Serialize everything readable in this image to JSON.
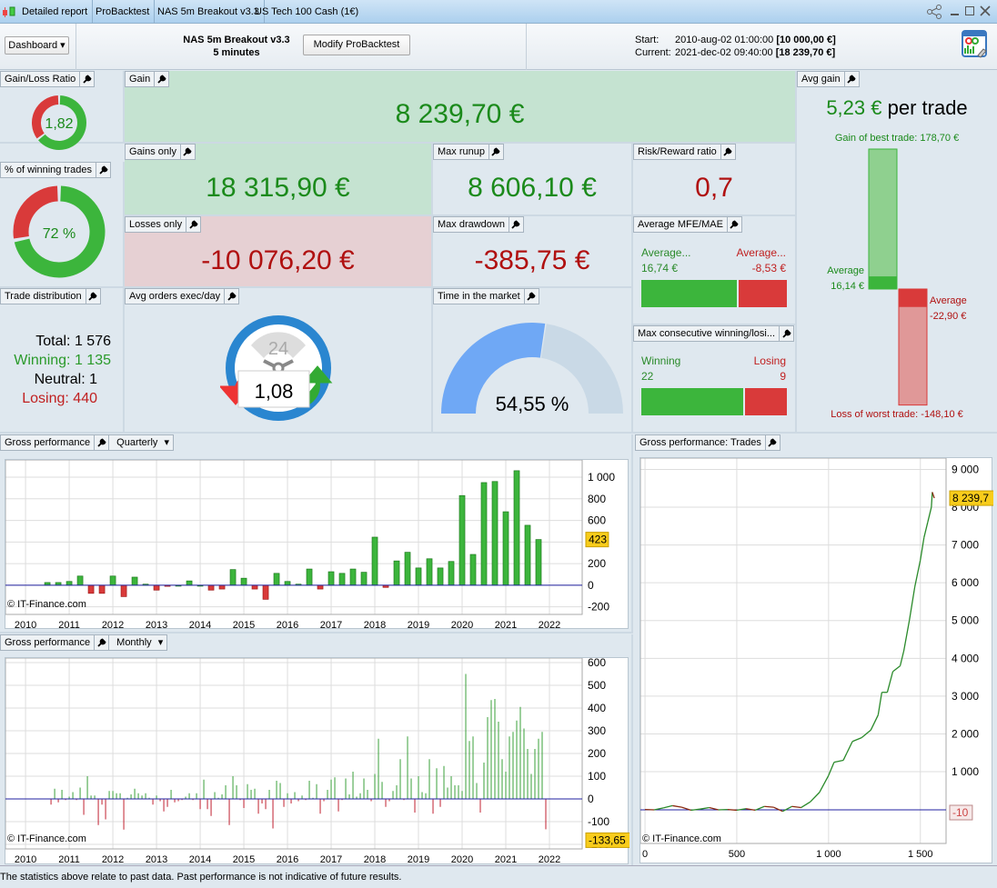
{
  "titlebar": {
    "tabs": [
      "Detailed report",
      "ProBacktest",
      "NAS 5m Breakout v3.3",
      "US Tech 100 Cash (1€)"
    ],
    "icons": [
      "candlestick-icon",
      "share-icon",
      "minimize-icon",
      "maximize-icon",
      "close-icon"
    ]
  },
  "header": {
    "dashboard_label": "Dashboard",
    "strategy_name": "NAS 5m Breakout v3.3",
    "timeframe": "5 minutes",
    "modify_label": "Modify ProBacktest",
    "start_label": "Start:",
    "start_date": "2010-aug-02 01:00:00",
    "start_capital": "[10 000,00 €]",
    "current_label": "Current:",
    "current_date": "2021-dec-02 09:40:00",
    "current_capital": "[18 239,70 €]"
  },
  "panels": {
    "gain_loss_ratio": {
      "label": "Gain/Loss Ratio",
      "value": "1,82",
      "ratio": 1.82
    },
    "winning_pct": {
      "label": "% of winning trades",
      "value": "72 %",
      "percent": 72
    },
    "trade_distribution": {
      "label": "Trade distribution",
      "total_label": "Total:",
      "total": "1 576",
      "winning_label": "Winning:",
      "winning": "1 135",
      "neutral_label": "Neutral:",
      "neutral": "1",
      "losing_label": "Losing:",
      "losing": "440"
    },
    "gain": {
      "label": "Gain",
      "value": "8 239,70 €"
    },
    "gains_only": {
      "label": "Gains only",
      "value": "18 315,90 €"
    },
    "losses_only": {
      "label": "Losses only",
      "value": "-10 076,20 €"
    },
    "max_runup": {
      "label": "Max runup",
      "value": "8 606,10 €"
    },
    "max_drawdown": {
      "label": "Max drawdown",
      "value": "-385,75 €"
    },
    "risk_reward": {
      "label": "Risk/Reward ratio",
      "value": "0,7"
    },
    "mfe_mae": {
      "label": "Average MFE/MAE",
      "left_label": "Average...",
      "left_value": "16,74 €",
      "right_label": "Average...",
      "right_value": "-8,53 €",
      "mfe": 16.74,
      "mae": 8.53
    },
    "max_consecutive": {
      "label": "Max consecutive winning/losi...",
      "left_label": "Winning",
      "left_value": "22",
      "right_label": "Losing",
      "right_value": "9",
      "winning": 22,
      "losing": 9
    },
    "avg_orders": {
      "label": "Avg orders exec/day",
      "value": "1,08",
      "clock_label": "24"
    },
    "time_in_market": {
      "label": "Time in the market",
      "value": "54,55 %",
      "percent": 54.55
    },
    "avg_gain": {
      "label": "Avg gain",
      "value": "5,23 €",
      "suffix": "per trade",
      "best_label": "Gain of best trade: 178,70 €",
      "avg_win_label": "Average",
      "avg_win_value": "16,14 €",
      "avg_loss_label": "Average",
      "avg_loss_value": "-22,90 €",
      "worst_label": "Loss of worst trade: -148,10 €",
      "best": 178.7,
      "avg_win": 16.14,
      "avg_loss": -22.9,
      "worst": -148.1
    }
  },
  "quarterly": {
    "label": "Gross performance",
    "period": "Quarterly",
    "watermark": "© IT-Finance.com",
    "last_label": "423"
  },
  "monthly": {
    "label": "Gross performance",
    "period": "Monthly",
    "watermark": "© IT-Finance.com",
    "last_label": "-133,65"
  },
  "trades": {
    "label": "Gross performance: Trades",
    "watermark": "© IT-Finance.com",
    "last_label": "8 239,7",
    "zero_label": "-10"
  },
  "footer": "The statistics above relate to past data. Past performance is not indicative of future results.",
  "colors": {
    "gain": "#1b8a1b",
    "loss": "#b01010",
    "bar_green": "#3cb53c",
    "bar_red": "#d93a3a",
    "gauge_blue": "#6fa8f5",
    "highlight": "#f8cc1b"
  },
  "chart_data": [
    {
      "type": "bar",
      "title": "Gross performance",
      "period": "Quarterly",
      "x_ticks": [
        "2010",
        "2011",
        "2012",
        "2013",
        "2014",
        "2015",
        "2016",
        "2017",
        "2018",
        "2019",
        "2020",
        "2021",
        "2022"
      ],
      "y_ticks": [
        "-200",
        "0",
        "200",
        "400",
        "600",
        "800",
        "1 000"
      ],
      "ylim": [
        -270,
        1160
      ],
      "grid": true,
      "categories": [
        "2010-Q3",
        "2010-Q4",
        "2011-Q1",
        "2011-Q2",
        "2011-Q3",
        "2011-Q4",
        "2012-Q1",
        "2012-Q2",
        "2012-Q3",
        "2012-Q4",
        "2013-Q1",
        "2013-Q2",
        "2013-Q3",
        "2013-Q4",
        "2014-Q1",
        "2014-Q2",
        "2014-Q3",
        "2014-Q4",
        "2015-Q1",
        "2015-Q2",
        "2015-Q3",
        "2015-Q4",
        "2016-Q1",
        "2016-Q2",
        "2016-Q3",
        "2016-Q4",
        "2017-Q1",
        "2017-Q2",
        "2017-Q3",
        "2017-Q4",
        "2018-Q1",
        "2018-Q2",
        "2018-Q3",
        "2018-Q4",
        "2019-Q1",
        "2019-Q2",
        "2019-Q3",
        "2019-Q4",
        "2020-Q1",
        "2020-Q2",
        "2020-Q3",
        "2020-Q4",
        "2021-Q1",
        "2021-Q2",
        "2021-Q3",
        "2021-Q4"
      ],
      "values": [
        25,
        25,
        35,
        85,
        -75,
        -75,
        85,
        -105,
        75,
        10,
        -45,
        -10,
        0,
        40,
        0,
        -45,
        -35,
        145,
        65,
        -35,
        -130,
        110,
        35,
        10,
        150,
        -35,
        125,
        110,
        150,
        120,
        445,
        -20,
        225,
        305,
        160,
        245,
        160,
        220,
        830,
        285,
        950,
        960,
        680,
        1060,
        555,
        423
      ]
    },
    {
      "type": "bar",
      "title": "Gross performance",
      "period": "Monthly",
      "x_ticks": [
        "2010",
        "2011",
        "2012",
        "2013",
        "2014",
        "2015",
        "2016",
        "2017",
        "2018",
        "2019",
        "2020",
        "2021",
        "2022"
      ],
      "y_ticks": [
        "-200",
        "-100",
        "0",
        "100",
        "200",
        "300",
        "400",
        "500",
        "600"
      ],
      "ylim": [
        -220,
        620
      ],
      "grid": true,
      "start": "2010-08",
      "end": "2021-12",
      "values": [
        -25,
        45,
        -15,
        40,
        -5,
        10,
        30,
        -5,
        50,
        -70,
        100,
        15,
        15,
        -115,
        -25,
        -90,
        35,
        35,
        25,
        25,
        -135,
        5,
        20,
        45,
        25,
        15,
        25,
        5,
        -25,
        15,
        -10,
        -55,
        -35,
        40,
        -15,
        -10,
        -5,
        10,
        25,
        -5,
        25,
        -45,
        85,
        -45,
        -75,
        30,
        5,
        20,
        60,
        -115,
        100,
        60,
        -5,
        -40,
        65,
        40,
        45,
        -65,
        -20,
        -45,
        40,
        -130,
        80,
        70,
        -35,
        25,
        -20,
        30,
        -10,
        15,
        -5,
        80,
        5,
        65,
        -65,
        -10,
        40,
        85,
        95,
        -55,
        -5,
        90,
        20,
        120,
        10,
        25,
        90,
        40,
        -10,
        110,
        265,
        75,
        -35,
        -10,
        35,
        60,
        175,
        -5,
        275,
        90,
        -60,
        100,
        30,
        25,
        175,
        -65,
        135,
        -35,
        145,
        50,
        100,
        60,
        60,
        35,
        550,
        255,
        275,
        70,
        -60,
        160,
        360,
        435,
        440,
        340,
        175,
        120,
        275,
        295,
        345,
        405,
        310,
        220,
        110,
        220,
        265,
        295,
        -133.65
      ]
    },
    {
      "type": "line",
      "title": "Gross performance: Trades",
      "x_ticks": [
        "0",
        "500",
        "1 000",
        "1 500"
      ],
      "y_ticks": [
        "1 000",
        "2 000",
        "3 000",
        "4 000",
        "5 000",
        "6 000",
        "7 000",
        "8 000",
        "9 000"
      ],
      "xlim": [
        -25,
        1640
      ],
      "ylim": [
        -900,
        9300
      ],
      "grid": true,
      "x": [
        0,
        50,
        100,
        150,
        200,
        250,
        300,
        350,
        400,
        450,
        500,
        550,
        600,
        650,
        700,
        750,
        800,
        850,
        900,
        950,
        1000,
        1030,
        1080,
        1100,
        1130,
        1180,
        1230,
        1270,
        1290,
        1320,
        1350,
        1390,
        1410,
        1440,
        1470,
        1500,
        1520,
        1540,
        1560,
        1565,
        1576
      ],
      "y": [
        0,
        -10,
        40,
        100,
        60,
        -20,
        10,
        50,
        -10,
        0,
        -20,
        20,
        -20,
        80,
        60,
        -50,
        80,
        50,
        200,
        450,
        900,
        1250,
        1300,
        1500,
        1800,
        1900,
        2100,
        2500,
        3100,
        3100,
        3650,
        3800,
        4200,
        5000,
        5900,
        6600,
        7200,
        7600,
        8000,
        8400,
        8240
      ]
    }
  ]
}
